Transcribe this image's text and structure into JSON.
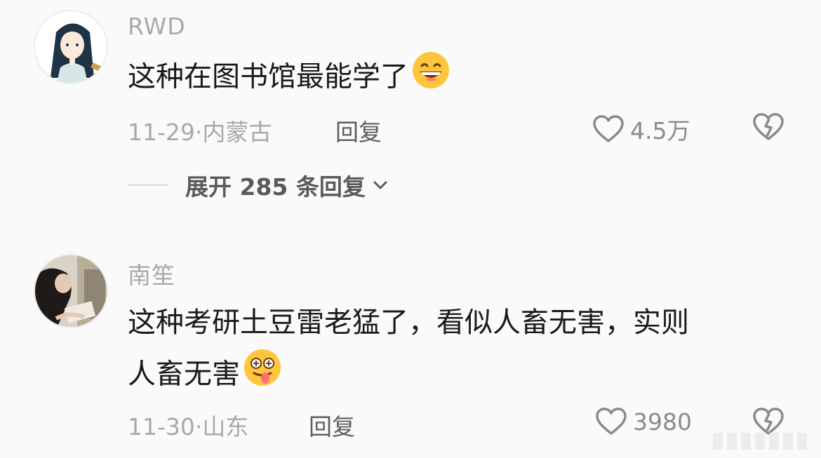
{
  "comments": [
    {
      "username": "RWD",
      "text": "这种在图书馆最能学了",
      "emoji": "grinning-face-emoji",
      "date": "11-29",
      "separator": "·",
      "location": "内蒙古",
      "reply_label": "回复",
      "likes": "4.5万",
      "expand_label": "展开 285 条回复"
    },
    {
      "username": "南笙",
      "text_line1": "这种考研土豆雷老猛了，看似人畜无害，实则",
      "text_line2": "人畜无害",
      "emoji": "woozy-tongue-face-emoji",
      "date": "11-30",
      "separator": "·",
      "location": "山东",
      "reply_label": "回复",
      "likes": "3980"
    }
  ],
  "colors": {
    "background": "#fafafa",
    "muted_text": "#a9a9a9",
    "primary_text": "#1a1a1a"
  }
}
